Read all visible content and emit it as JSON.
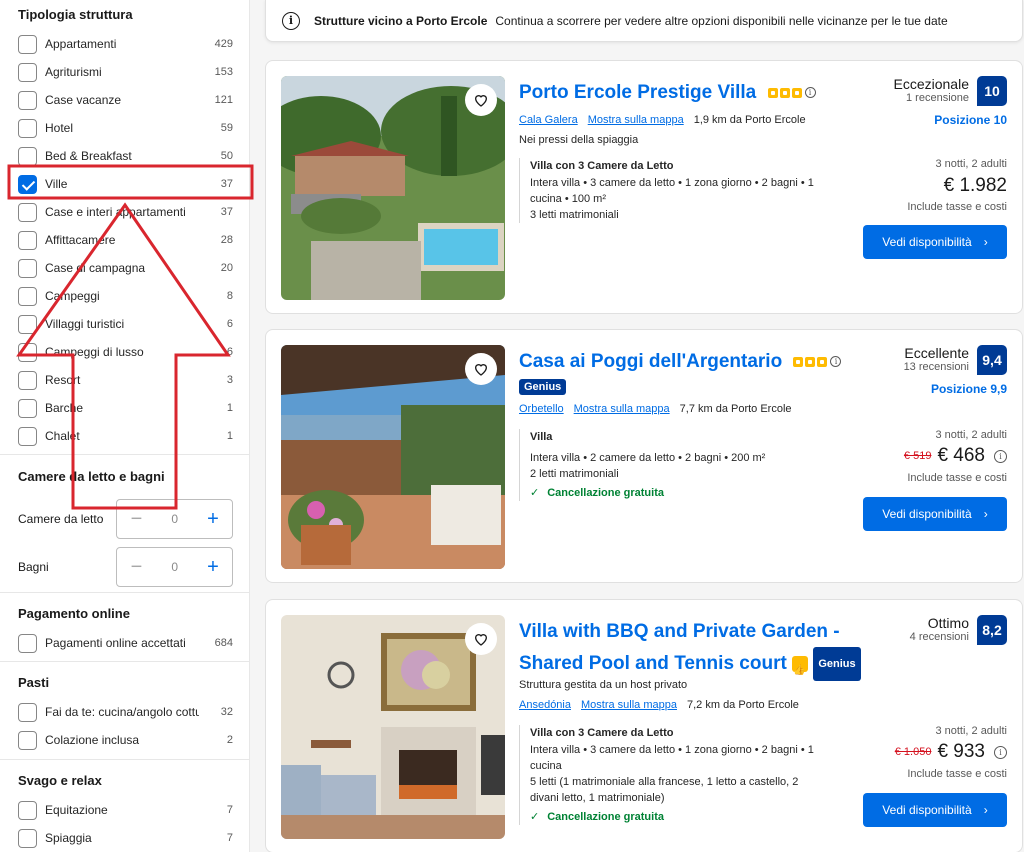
{
  "sidebar": {
    "structure": {
      "title": "Tipologia struttura",
      "items": [
        {
          "label": "Appartamenti",
          "count": "429",
          "checked": false
        },
        {
          "label": "Agriturismi",
          "count": "153",
          "checked": false
        },
        {
          "label": "Case vacanze",
          "count": "121",
          "checked": false
        },
        {
          "label": "Hotel",
          "count": "59",
          "checked": false
        },
        {
          "label": "Bed & Breakfast",
          "count": "50",
          "checked": false
        },
        {
          "label": "Ville",
          "count": "37",
          "checked": true
        },
        {
          "label": "Case e interi appartamenti",
          "count": "37",
          "checked": false
        },
        {
          "label": "Affittacamere",
          "count": "28",
          "checked": false
        },
        {
          "label": "Case di campagna",
          "count": "20",
          "checked": false
        },
        {
          "label": "Campeggi",
          "count": "8",
          "checked": false
        },
        {
          "label": "Villaggi turistici",
          "count": "6",
          "checked": false
        },
        {
          "label": "Campeggi di lusso",
          "count": "6",
          "checked": false
        },
        {
          "label": "Resort",
          "count": "3",
          "checked": false
        },
        {
          "label": "Barche",
          "count": "1",
          "checked": false
        },
        {
          "label": "Chalet",
          "count": "1",
          "checked": false
        }
      ]
    },
    "rooms": {
      "title": "Camere da letto e bagni",
      "bedrooms_label": "Camere da letto",
      "bedrooms_value": "0",
      "bathrooms_label": "Bagni",
      "bathrooms_value": "0"
    },
    "payment": {
      "title": "Pagamento online",
      "items": [
        {
          "label": "Pagamenti online accettati",
          "count": "684"
        }
      ]
    },
    "meals": {
      "title": "Pasti",
      "items": [
        {
          "label": "Fai da te: cucina/angolo cottura",
          "count": "32"
        },
        {
          "label": "Colazione inclusa",
          "count": "2"
        }
      ]
    },
    "leisure": {
      "title": "Svago e relax",
      "items": [
        {
          "label": "Equitazione",
          "count": "7"
        },
        {
          "label": "Spiaggia",
          "count": "7"
        }
      ]
    }
  },
  "info_bar": {
    "bold": "Strutture vicino a Porto Ercole",
    "text": "Continua a scorrere per vedere altre opzioni disponibili nelle vicinanze per le tue date"
  },
  "cards": [
    {
      "title": "Porto Ercole Prestige Villa",
      "stars": 3,
      "loc_link": "Cala Galera",
      "map_link": "Mostra sulla mappa",
      "distance": "1,9 km da Porto Ercole",
      "near": "Nei pressi della spiaggia",
      "unit_name": "Villa con 3 Camere da Letto",
      "unit_desc": "Intera villa • 3 camere da letto • 1 zona giorno • 2 bagni • 1 cucina • 100 m²",
      "beds": "3 letti matrimoniali",
      "review_word": "Eccezionale",
      "review_count": "1 recensione",
      "score": "10",
      "position": "Posizione 10",
      "nights": "3 notti, 2 adulti",
      "price": "€ 1.982",
      "taxes": "Include tasse e costi",
      "cta": "Vedi disponibilità"
    },
    {
      "title": "Casa ai Poggi dell'Argentario",
      "stars": 3,
      "genius": "Genius",
      "loc_link": "Orbetello",
      "map_link": "Mostra sulla mappa",
      "distance": "7,7 km da Porto Ercole",
      "unit_name": "Villa",
      "unit_desc": "Intera villa • 2 camere da letto • 2 bagni • 200 m²",
      "beds": "2 letti matrimoniali",
      "cancel": "Cancellazione gratuita",
      "review_word": "Eccellente",
      "review_count": "13 recensioni",
      "score": "9,4",
      "position": "Posizione 9,9",
      "nights": "3 notti, 2 adulti",
      "old_price": "€ 519",
      "price": "€ 468",
      "taxes": "Include tasse e costi",
      "cta": "Vedi disponibilità"
    },
    {
      "title_line1": "Villa with BBQ and Private Garden -",
      "title_line2": "Shared Pool and Tennis court",
      "genius": "Genius",
      "host": "Struttura gestita da un host privato",
      "loc_link": "Ansedónia",
      "map_link": "Mostra sulla mappa",
      "distance": "7,2 km da Porto Ercole",
      "unit_name": "Villa con 3 Camere da Letto",
      "unit_desc": "Intera villa • 3 camere da letto • 1 zona giorno • 2 bagni • 1 cucina",
      "beds": "5 letti (1 matrimoniale alla francese, 1 letto a castello, 2 divani letto, 1 matrimoniale)",
      "cancel": "Cancellazione gratuita",
      "review_word": "Ottimo",
      "review_count": "4 recensioni",
      "score": "8,2",
      "nights": "3 notti, 2 adulti",
      "old_price": "€ 1.050",
      "price": "€ 933",
      "taxes": "Include tasse e costi",
      "cta": "Vedi disponibilità"
    }
  ],
  "colors": {
    "brand_blue": "#006ce4",
    "dark_blue": "#003b95",
    "annotation_red": "#d9262e",
    "star_yellow": "#febb02",
    "green": "#008234"
  },
  "icons": [
    "info-icon",
    "heart-icon",
    "star-icon",
    "chevron-right-icon",
    "checkmark-icon",
    "thumbs-up-icon"
  ]
}
